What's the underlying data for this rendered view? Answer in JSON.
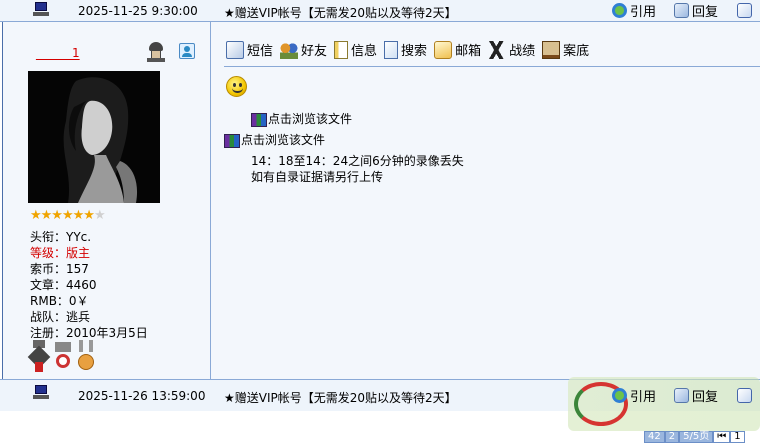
{
  "posts": {
    "first": {
      "date": "2025-11-25 9:30:00",
      "title": "★赠送VIP帐号【无需发20贴以及等待2天】",
      "quote_label": "引用",
      "reply_label": "回复"
    },
    "second": {
      "date": "2025-11-26 13:59:00",
      "title": "★赠送VIP帐号【无需发20贴以及等待2天】",
      "quote_label": "引用",
      "reply_label": "回复"
    }
  },
  "user": {
    "name": "______1",
    "rating_filled": 6,
    "rating_total": 7,
    "fields": [
      {
        "label": "头衔：YYc.",
        "red": false
      },
      {
        "label": "等级：版主",
        "red": true
      },
      {
        "label": "索币：157",
        "red": false
      },
      {
        "label": "文章：4460",
        "red": false
      },
      {
        "label": "RMB：0￥",
        "red": false
      },
      {
        "label": "战队：逃兵",
        "red": false
      },
      {
        "label": "注册：2010年3月5日",
        "red": false
      }
    ]
  },
  "toolbar": {
    "sms": "短信",
    "friend": "好友",
    "info": "信息",
    "search": "搜索",
    "mail": "邮箱",
    "record": "战绩",
    "bottom": "案底"
  },
  "content": {
    "attachment1": "点击浏览该文件",
    "attachment2": "点击浏览该文件",
    "line1": "14：18至14：24之间6分钟的录像丢失",
    "line2": "如有自录证据请另行上传"
  },
  "pager": {
    "items": [
      "42",
      "2",
      "5/5页",
      "1"
    ]
  },
  "icons": {
    "post_icon": "computer-icon",
    "quote": "quote-icon",
    "reply": "reply-icon",
    "edit": "edit-icon"
  }
}
